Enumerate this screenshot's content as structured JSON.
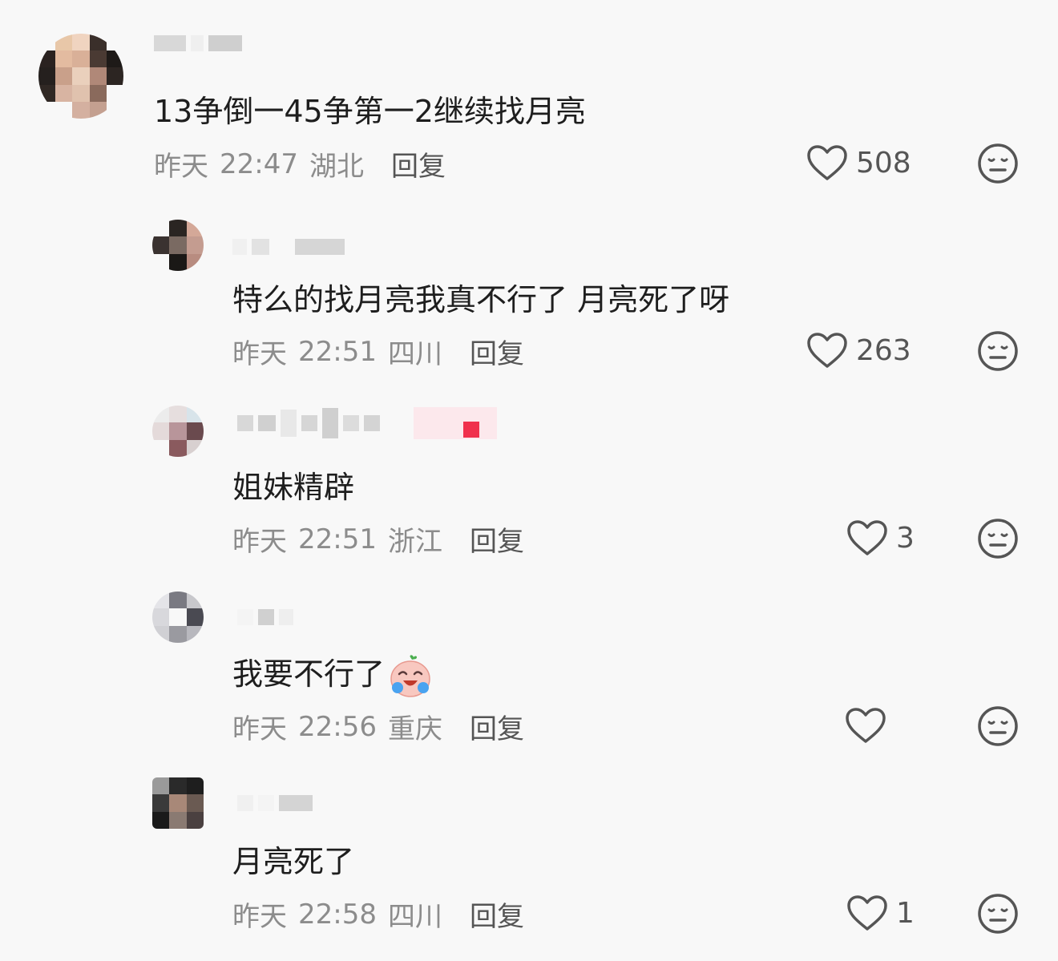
{
  "comments": [
    {
      "text": "13争倒一45争第一2继续找月亮",
      "date": "昨天",
      "time": "22:47",
      "location": "湖北",
      "reply_label": "回复",
      "likes": "508"
    },
    {
      "text": "特么的找月亮我真不行了 月亮死了呀",
      "date": "昨天",
      "time": "22:51",
      "location": "四川",
      "reply_label": "回复",
      "likes": "263"
    },
    {
      "text": "姐妹精辟",
      "date": "昨天",
      "time": "22:51",
      "location": "浙江",
      "reply_label": "回复",
      "likes": "3"
    },
    {
      "text": "我要不行了",
      "emoji": "crying-laugh-emoji",
      "date": "昨天",
      "time": "22:56",
      "location": "重庆",
      "reply_label": "回复",
      "likes": ""
    },
    {
      "text": "月亮死了",
      "date": "昨天",
      "time": "22:58",
      "location": "四川",
      "reply_label": "回复",
      "likes": "1"
    }
  ],
  "icons": {
    "like": "heart-outline-icon",
    "dislike": "neutral-face-icon"
  },
  "colors": {
    "background": "#f8f8f8",
    "text": "#1e1e1e",
    "meta": "#8c8c8c",
    "icon": "#555555"
  }
}
